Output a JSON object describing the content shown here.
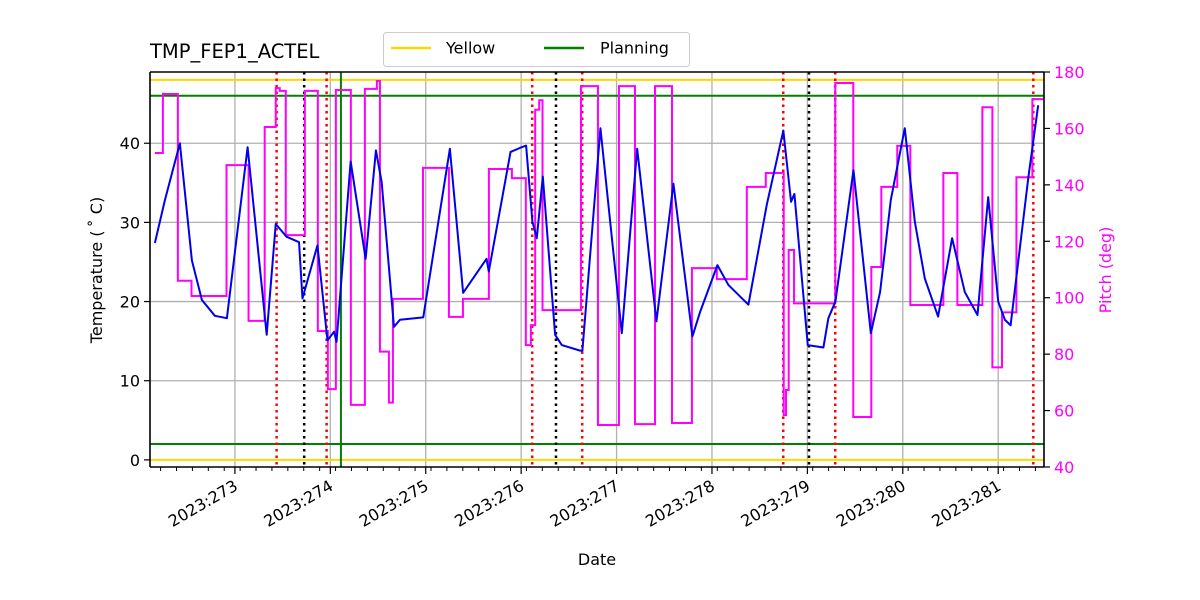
{
  "chart_data": {
    "type": "line",
    "title": "TMP_FEP1_ACTEL",
    "xlabel": "Date",
    "ylabel": "Temperature ($^\\circ$C)",
    "ylabel_display": "Temperature ( ˚ C)",
    "y2label": "Pitch (deg)",
    "xlim": [
      272.11,
      281.48
    ],
    "ylim": [
      -0.9,
      49.0
    ],
    "y2lim": [
      40,
      180
    ],
    "grid": true,
    "legend_placement": "top-center-outside",
    "x_ticks": [
      {
        "value": 273,
        "label": "2023:273"
      },
      {
        "value": 274,
        "label": "2023:274"
      },
      {
        "value": 275,
        "label": "2023:275"
      },
      {
        "value": 276,
        "label": "2023:276"
      },
      {
        "value": 277,
        "label": "2023:277"
      },
      {
        "value": 278,
        "label": "2023:278"
      },
      {
        "value": 279,
        "label": "2023:279"
      },
      {
        "value": 280,
        "label": "2023:280"
      },
      {
        "value": 281,
        "label": "2023:281"
      }
    ],
    "x_minor_step_days": 0.1667,
    "y_ticks": [
      0,
      10,
      20,
      30,
      40
    ],
    "y2_ticks": [
      40,
      60,
      80,
      100,
      120,
      140,
      160,
      180
    ],
    "colors": {
      "temperature": "#0000ee",
      "pitch": "#ff00ff",
      "yellow": "#ffd700",
      "planning": "#008000",
      "grid": "#b0b0b0",
      "red_marker": "#ff0000",
      "black_marker": "#000000",
      "axis": "#000000"
    },
    "legend": [
      {
        "name": "Yellow",
        "color": "#ffd700"
      },
      {
        "name": "Planning",
        "color": "#008000"
      }
    ],
    "limit_lines": [
      {
        "name": "Yellow",
        "kind": "yellow",
        "value": 48.0
      },
      {
        "name": "Yellow",
        "kind": "yellow",
        "value": 0.0
      },
      {
        "name": "Planning",
        "kind": "planning",
        "value": 46.0
      },
      {
        "name": "Planning",
        "kind": "planning",
        "value": 2.0
      }
    ],
    "vertical_lines": [
      {
        "day": 273.437,
        "kind": "red_dotted"
      },
      {
        "day": 273.726,
        "kind": "black_dotted"
      },
      {
        "day": 273.961,
        "kind": "red_dotted"
      },
      {
        "day": 274.111,
        "kind": "green_solid"
      },
      {
        "day": 276.116,
        "kind": "red_dotted"
      },
      {
        "day": 276.365,
        "kind": "black_dotted"
      },
      {
        "day": 276.64,
        "kind": "red_dotted"
      },
      {
        "day": 278.747,
        "kind": "red_dotted"
      },
      {
        "day": 279.017,
        "kind": "black_dotted"
      },
      {
        "day": 279.292,
        "kind": "red_dotted"
      },
      {
        "day": 281.368,
        "kind": "red_dotted"
      }
    ],
    "series": [
      {
        "name": "Temperature",
        "axis": "left",
        "style": "line",
        "points": [
          [
            272.161,
            27.4
          ],
          [
            272.266,
            32.8
          ],
          [
            272.423,
            40.0
          ],
          [
            272.549,
            25.2
          ],
          [
            272.654,
            20.2
          ],
          [
            272.79,
            18.2
          ],
          [
            272.916,
            17.9
          ],
          [
            273.133,
            39.5
          ],
          [
            273.333,
            15.8
          ],
          [
            273.428,
            29.8
          ],
          [
            273.54,
            28.2
          ],
          [
            273.672,
            27.5
          ],
          [
            273.708,
            20.4
          ],
          [
            273.865,
            27.1
          ],
          [
            273.97,
            15.1
          ],
          [
            274.04,
            16.2
          ],
          [
            274.065,
            14.9
          ],
          [
            274.213,
            37.7
          ],
          [
            274.37,
            25.4
          ],
          [
            274.478,
            39.1
          ],
          [
            274.538,
            35.1
          ],
          [
            274.667,
            16.8
          ],
          [
            274.73,
            17.7
          ],
          [
            274.974,
            18.0
          ],
          [
            275.253,
            39.3
          ],
          [
            275.392,
            21.1
          ],
          [
            275.637,
            25.4
          ],
          [
            275.661,
            23.8
          ],
          [
            275.889,
            38.9
          ],
          [
            275.986,
            39.4
          ],
          [
            276.052,
            39.7
          ],
          [
            276.118,
            30.1
          ],
          [
            276.164,
            28.0
          ],
          [
            276.227,
            35.8
          ],
          [
            276.356,
            15.8
          ],
          [
            276.426,
            14.5
          ],
          [
            276.618,
            13.8
          ],
          [
            276.642,
            13.8
          ],
          [
            276.831,
            41.9
          ],
          [
            277.055,
            16.0
          ],
          [
            277.216,
            39.3
          ],
          [
            277.418,
            17.5
          ],
          [
            277.596,
            34.9
          ],
          [
            277.795,
            15.6
          ],
          [
            277.876,
            18.7
          ],
          [
            278.057,
            24.6
          ],
          [
            278.172,
            22.1
          ],
          [
            278.382,
            19.6
          ],
          [
            278.574,
            32.2
          ],
          [
            278.585,
            32.8
          ],
          [
            278.748,
            41.6
          ],
          [
            278.829,
            32.6
          ],
          [
            278.864,
            33.6
          ],
          [
            279.004,
            14.5
          ],
          [
            279.168,
            14.2
          ],
          [
            279.22,
            17.9
          ],
          [
            279.294,
            20.0
          ],
          [
            279.483,
            36.6
          ],
          [
            279.665,
            16.0
          ],
          [
            279.762,
            21.2
          ],
          [
            279.874,
            32.8
          ],
          [
            280.021,
            41.9
          ],
          [
            280.126,
            30.1
          ],
          [
            280.231,
            22.9
          ],
          [
            280.37,
            18.1
          ],
          [
            280.517,
            28.0
          ],
          [
            280.65,
            21.2
          ],
          [
            280.783,
            18.3
          ],
          [
            280.895,
            33.2
          ],
          [
            281.0,
            20.0
          ],
          [
            281.07,
            17.7
          ],
          [
            281.13,
            17.0
          ],
          [
            281.314,
            35.5
          ],
          [
            281.419,
            44.8
          ]
        ]
      },
      {
        "name": "Pitch",
        "axis": "right",
        "style": "step",
        "steps": [
          [
            272.161,
            151.3
          ],
          [
            272.245,
            172.2
          ],
          [
            272.402,
            106.0
          ],
          [
            272.545,
            100.6
          ],
          [
            272.912,
            147.0
          ],
          [
            273.143,
            91.8
          ],
          [
            273.312,
            160.5
          ],
          [
            273.428,
            174.3
          ],
          [
            273.47,
            173.3
          ],
          [
            273.533,
            122.2
          ],
          [
            273.733,
            173.3
          ],
          [
            273.869,
            88.2
          ],
          [
            273.974,
            67.6
          ],
          [
            274.058,
            173.6
          ],
          [
            274.215,
            62.0
          ],
          [
            274.362,
            174.0
          ],
          [
            274.488,
            176.8
          ],
          [
            274.52,
            80.9
          ],
          [
            274.614,
            62.8
          ],
          [
            274.656,
            99.6
          ],
          [
            274.971,
            146.0
          ],
          [
            275.243,
            93.2
          ],
          [
            275.39,
            99.6
          ],
          [
            275.662,
            145.6
          ],
          [
            275.903,
            142.4
          ],
          [
            276.049,
            83.2
          ],
          [
            276.102,
            90.3
          ],
          [
            276.147,
            166.6
          ],
          [
            276.189,
            170.0
          ],
          [
            276.224,
            95.6
          ],
          [
            276.627,
            175.0
          ],
          [
            276.805,
            54.9
          ],
          [
            277.025,
            175.0
          ],
          [
            277.193,
            55.2
          ],
          [
            277.403,
            175.0
          ],
          [
            277.581,
            55.6
          ],
          [
            277.79,
            110.5
          ],
          [
            278.051,
            106.6
          ],
          [
            278.365,
            139.3
          ],
          [
            278.564,
            144.2
          ],
          [
            278.752,
            58.4
          ],
          [
            278.776,
            67.3
          ],
          [
            278.804,
            116.9
          ],
          [
            278.86,
            98.0
          ],
          [
            279.292,
            176.1
          ],
          [
            279.481,
            57.7
          ],
          [
            279.67,
            110.9
          ],
          [
            279.775,
            139.3
          ],
          [
            279.942,
            153.8
          ],
          [
            280.079,
            97.4
          ],
          [
            280.425,
            144.2
          ],
          [
            280.572,
            97.4
          ],
          [
            280.834,
            167.5
          ],
          [
            280.939,
            75.3
          ],
          [
            281.04,
            94.8
          ],
          [
            281.191,
            142.7
          ],
          [
            281.358,
            170.4
          ],
          [
            281.48,
            170.4
          ]
        ]
      }
    ]
  }
}
